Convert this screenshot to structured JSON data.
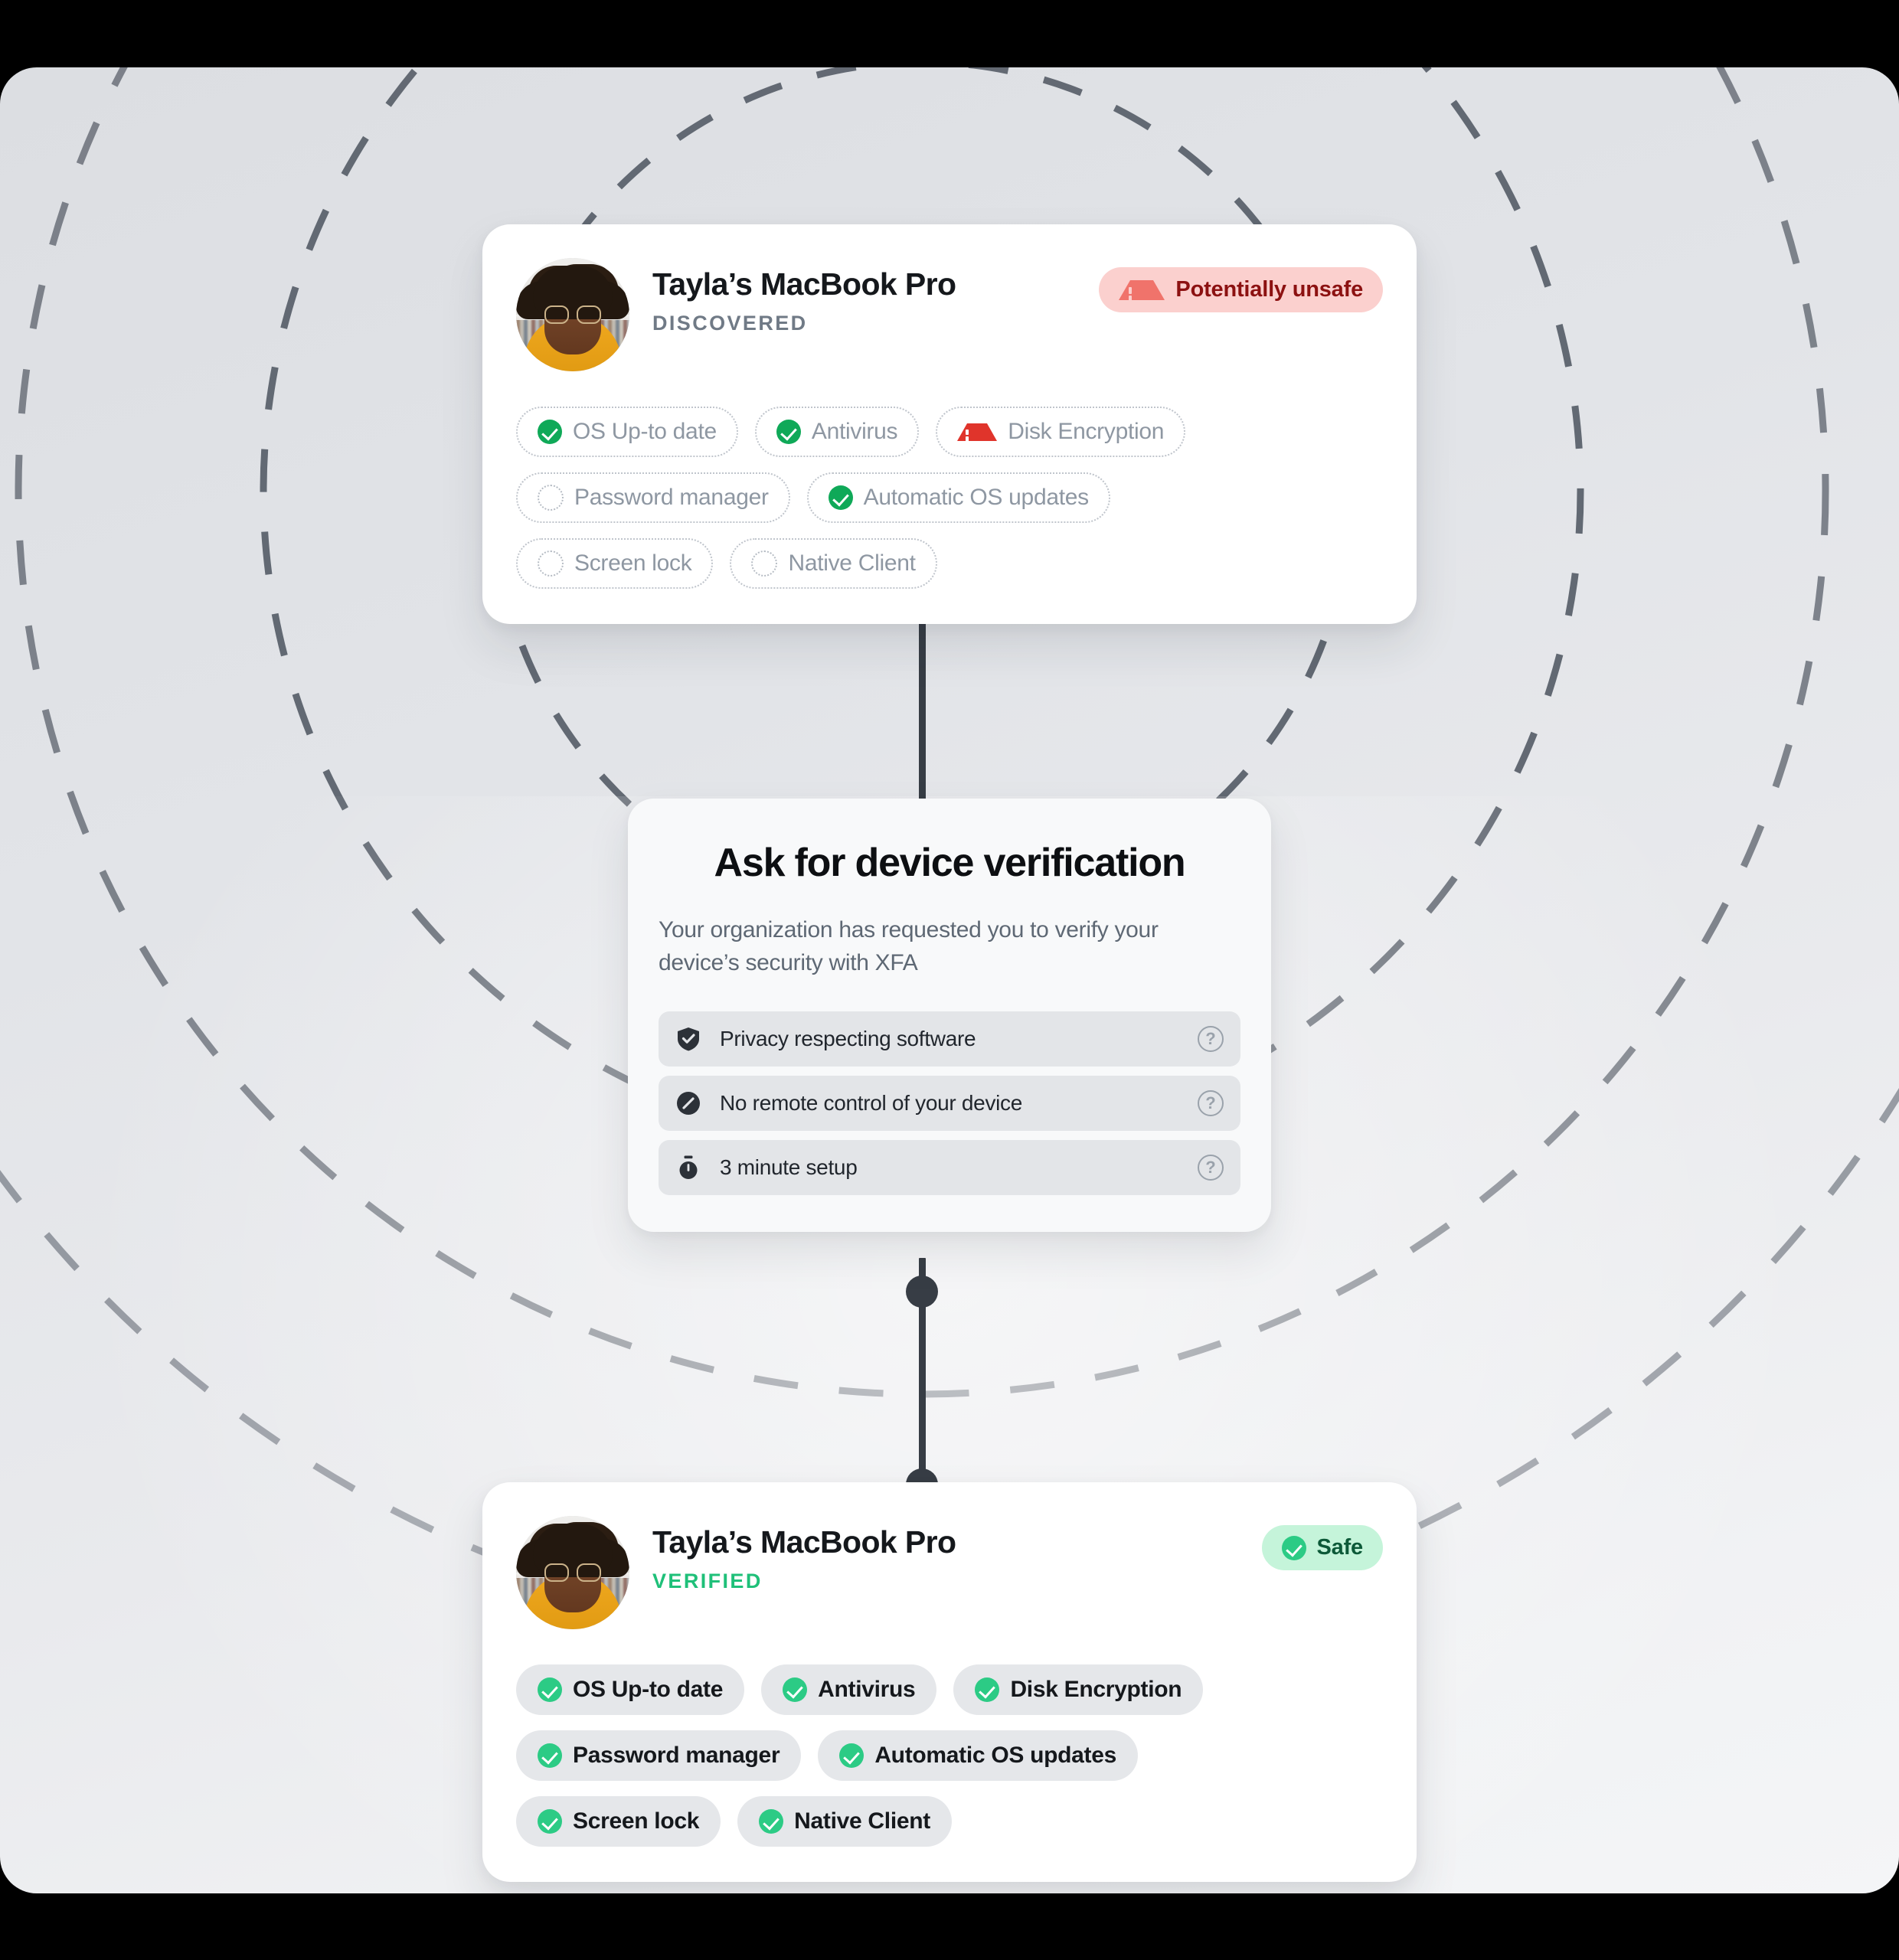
{
  "colors": {
    "panel_bg": "#E2E4E8",
    "card_bg": "#FFFFFF",
    "prompt_bg": "#F8F9FA",
    "connector": "#373D45",
    "unsafe_bg": "#FBD0CE",
    "unsafe_text": "#8C1111",
    "safe_bg": "#C5F4DA",
    "safe_text": "#0C5938",
    "verified_green": "#1FC079",
    "check_green": "#0FA958",
    "alert_red": "#E0342B",
    "muted_text": "#8E97A2"
  },
  "top_device_card": {
    "avatar_name": "user-avatar",
    "device_name": "Tayla’s MacBook Pro",
    "state_label": "DISCOVERED",
    "status_badge": {
      "label": "Potentially unsafe",
      "icon": "warning-triangle-icon",
      "tone": "unsafe"
    },
    "tags": [
      {
        "label": "OS Up-to date",
        "icon": "check-circle-icon",
        "state": "pass"
      },
      {
        "label": "Antivirus",
        "icon": "check-circle-icon",
        "state": "pass"
      },
      {
        "label": "Disk Encryption",
        "icon": "warning-triangle-icon",
        "state": "fail"
      },
      {
        "label": "Password manager",
        "icon": "empty-circle-icon",
        "state": "unknown"
      },
      {
        "label": "Automatic OS updates",
        "icon": "check-circle-icon",
        "state": "pass"
      },
      {
        "label": "Screen lock",
        "icon": "empty-circle-icon",
        "state": "unknown"
      },
      {
        "label": "Native Client",
        "icon": "empty-circle-icon",
        "state": "unknown"
      }
    ]
  },
  "prompt_card": {
    "title": "Ask for device verification",
    "subtitle": "Your organization has requested you to verify your device’s security with XFA",
    "features": [
      {
        "label": "Privacy respecting software",
        "icon": "shield-check-icon",
        "help_icon": "help-circle-icon"
      },
      {
        "label": "No remote control of your device",
        "icon": "no-remote-icon",
        "help_icon": "help-circle-icon"
      },
      {
        "label": "3 minute setup",
        "icon": "stopwatch-icon",
        "help_icon": "help-circle-icon"
      }
    ],
    "help_glyph": "?"
  },
  "bottom_device_card": {
    "avatar_name": "user-avatar",
    "device_name": "Tayla’s MacBook Pro",
    "state_label": "VERIFIED",
    "status_badge": {
      "label": "Safe",
      "icon": "check-circle-icon",
      "tone": "safe"
    },
    "tags": [
      {
        "label": "OS Up-to date",
        "icon": "check-circle-icon",
        "state": "pass"
      },
      {
        "label": "Antivirus",
        "icon": "check-circle-icon",
        "state": "pass"
      },
      {
        "label": "Disk Encryption",
        "icon": "check-circle-icon",
        "state": "pass"
      },
      {
        "label": "Password manager",
        "icon": "check-circle-icon",
        "state": "pass"
      },
      {
        "label": "Automatic OS updates",
        "icon": "check-circle-icon",
        "state": "pass"
      },
      {
        "label": "Screen lock",
        "icon": "check-circle-icon",
        "state": "pass"
      },
      {
        "label": "Native Client",
        "icon": "check-circle-icon",
        "state": "pass"
      }
    ]
  }
}
